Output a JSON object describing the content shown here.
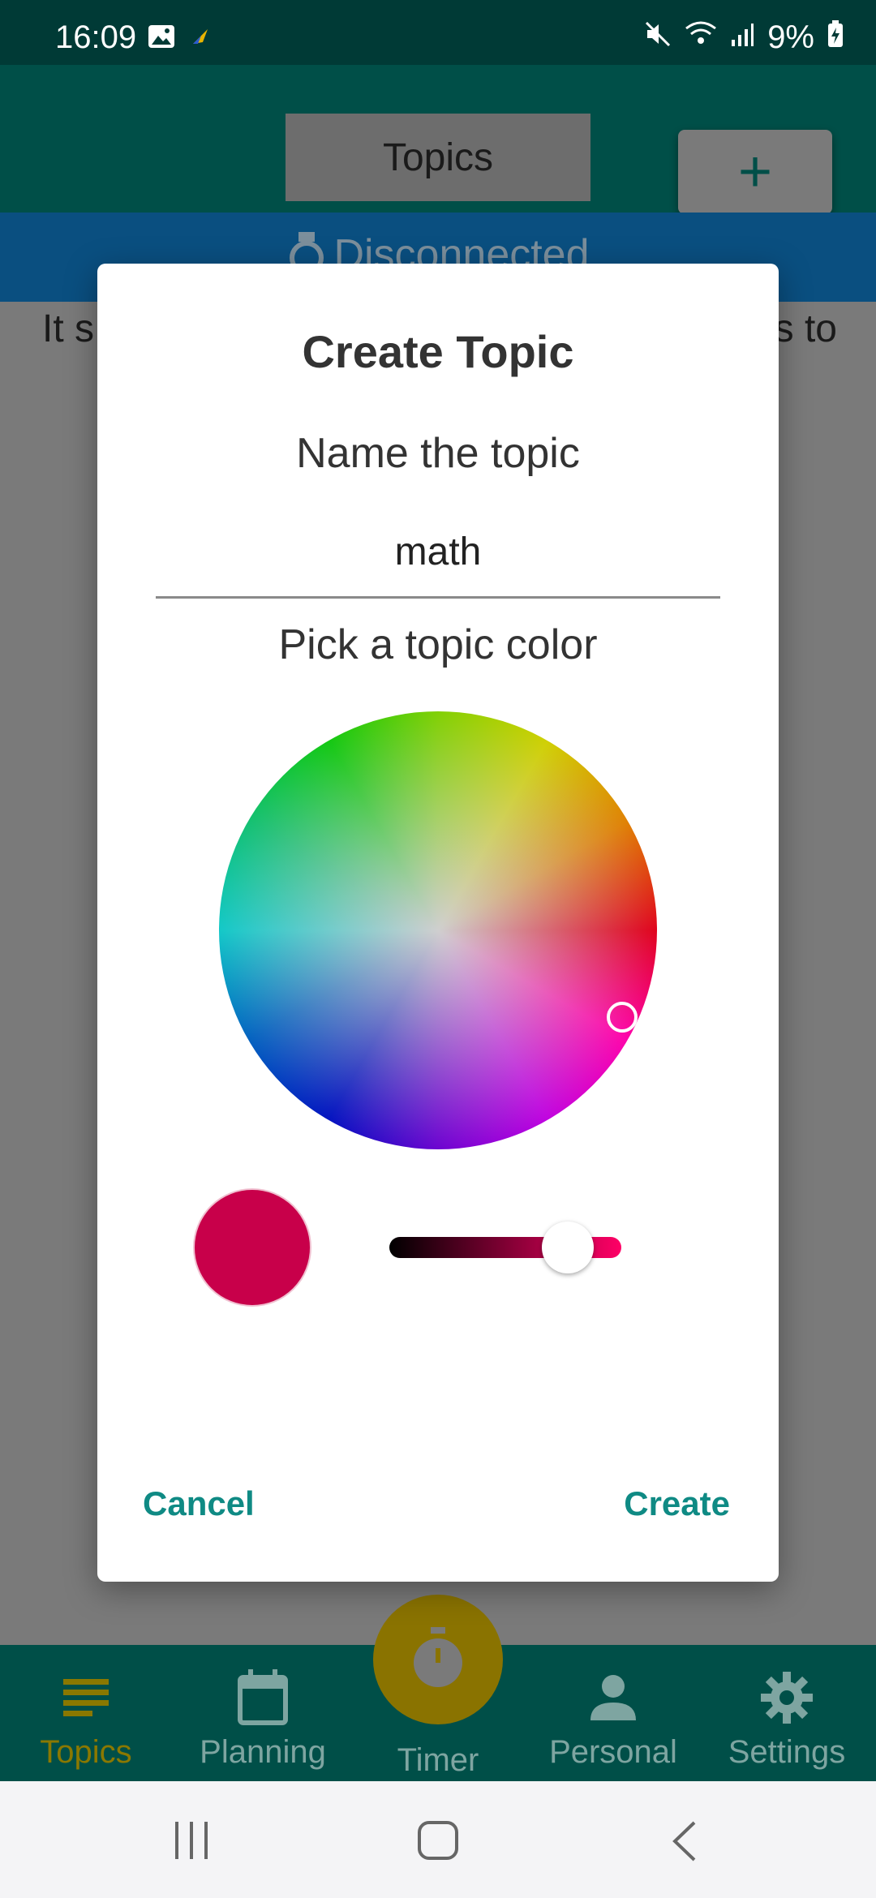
{
  "status_bar": {
    "time": "16:09",
    "battery": "9%",
    "icons": [
      "gallery-icon",
      "notification-icon",
      "mute-icon",
      "wifi-icon",
      "signal-icon",
      "battery-charging-icon"
    ]
  },
  "header": {
    "title": "Topics",
    "add_label": "+"
  },
  "banner": {
    "text": "Disconnected"
  },
  "background_text": {
    "left": "It s",
    "right": "s to"
  },
  "dialog": {
    "title": "Create Topic",
    "name_label": "Name the topic",
    "name_value": "math",
    "color_label": "Pick a topic color",
    "selected_color": "#c8004a",
    "brightness_level": 0.77,
    "cancel_label": "Cancel",
    "create_label": "Create"
  },
  "bottom_nav": {
    "items": [
      {
        "label": "Topics",
        "icon": "list-icon",
        "active": true
      },
      {
        "label": "Planning",
        "icon": "calendar-icon",
        "active": false
      },
      {
        "label": "Timer",
        "icon": "stopwatch-icon",
        "active": false
      },
      {
        "label": "Personal",
        "icon": "person-icon",
        "active": false
      },
      {
        "label": "Settings",
        "icon": "gear-icon",
        "active": false
      }
    ]
  },
  "colors": {
    "accent": "#0f8a84",
    "app_bar": "#004f48",
    "active_nav": "#8a7800"
  }
}
